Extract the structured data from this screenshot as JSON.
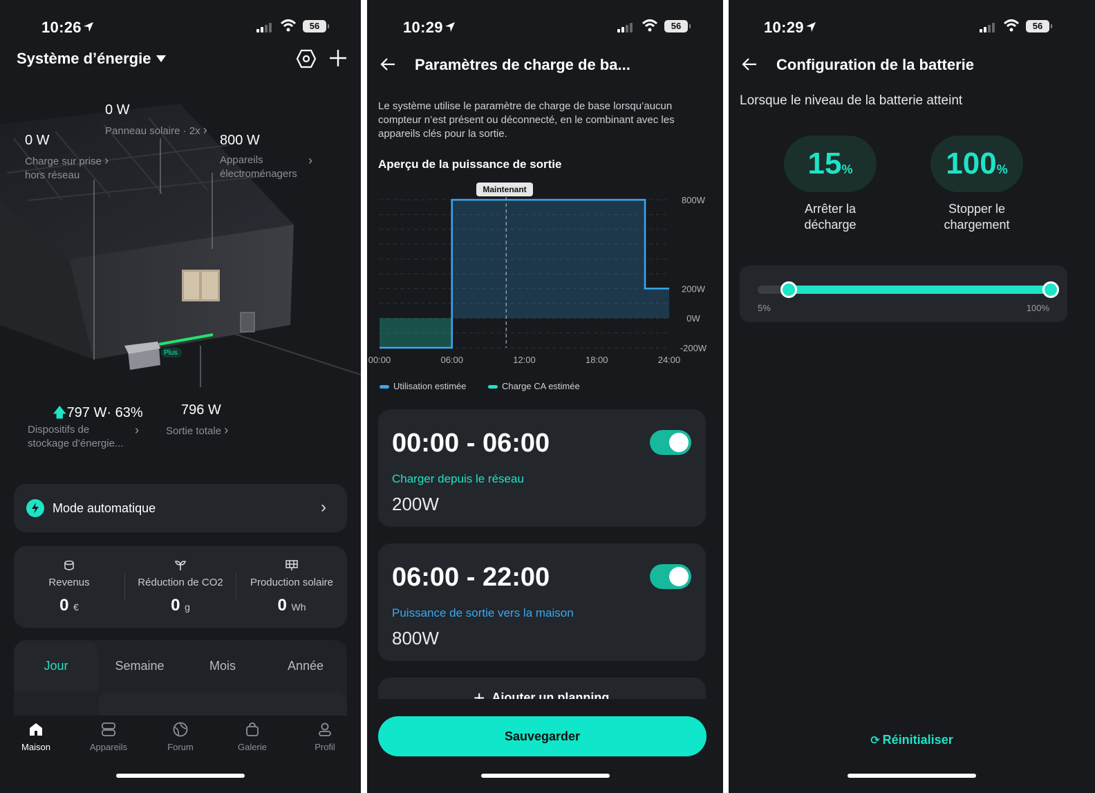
{
  "status": {
    "screen1_time": "10:26",
    "screen2_time": "10:29",
    "screen3_time": "10:29",
    "battery": "56"
  },
  "screen1": {
    "title": "Système d’énergie",
    "solar": {
      "value": "0 W",
      "label": "Panneau solaire · 2x"
    },
    "offgrid": {
      "value": "0 W",
      "label_line1": "Charge sur prise",
      "label_line2": "hors réseau"
    },
    "appliances": {
      "value": "800 W",
      "label_line1": "Appareils",
      "label_line2": "électroménagers"
    },
    "storage": {
      "value": "797 W· 63%",
      "label_line1": "Dispositifs de",
      "label_line2": "stockage d’énergie..."
    },
    "output": {
      "value": "796 W",
      "label": "Sortie totale"
    },
    "device_badge": "Plus",
    "auto_mode": "Mode automatique",
    "stats": [
      {
        "label": "Revenus",
        "value": "0",
        "unit": "€"
      },
      {
        "label": "Réduction de CO2",
        "value": "0",
        "unit": "g"
      },
      {
        "label": "Production solaire",
        "value": "0",
        "unit": "Wh"
      }
    ],
    "period_tabs": [
      "Jour",
      "Semaine",
      "Mois",
      "Année"
    ],
    "nav": [
      "Maison",
      "Appareils",
      "Forum",
      "Galerie",
      "Profil"
    ]
  },
  "screen2": {
    "title": "Paramètres de charge de ba...",
    "description": "Le système utilise le paramètre de charge de base lorsqu’aucun compteur n’est présent ou déconnecté, en le combinant avec les appareils clés pour la sortie.",
    "chart_title": "Aperçu de la puissance de sortie",
    "now_label": "Maintenant",
    "legend": [
      "Utilisation estimée",
      "Charge CA estimée"
    ],
    "schedules": [
      {
        "range": "00:00 - 06:00",
        "mode": "Charger depuis le réseau",
        "power": "200W"
      },
      {
        "range": "06:00 - 22:00",
        "mode": "Puissance de sortie vers la maison",
        "power": "800W"
      }
    ],
    "add_schedule": "Ajouter un planning",
    "save": "Sauvegarder"
  },
  "chart_data": {
    "type": "area",
    "x_ticks": [
      "00:00",
      "06:00",
      "12:00",
      "18:00",
      "24:00"
    ],
    "y_ticks": [
      "800W",
      "200W",
      "0W",
      "-200W"
    ],
    "ylim": [
      -200,
      800
    ],
    "xlim": [
      0,
      24
    ],
    "now_hour": 10.5,
    "series": [
      {
        "name": "Utilisation estimée",
        "color": "#3aa8f0",
        "points": [
          [
            0,
            -200
          ],
          [
            6,
            -200
          ],
          [
            6,
            800
          ],
          [
            22,
            800
          ],
          [
            22,
            200
          ],
          [
            24,
            200
          ]
        ]
      },
      {
        "name": "Charge CA estimée",
        "color": "#1fe3c6",
        "points": [
          [
            0,
            0
          ],
          [
            6,
            0
          ]
        ]
      }
    ]
  },
  "screen3": {
    "title": "Configuration de la batterie",
    "subtitle": "Lorsque le niveau de la batterie atteint",
    "discharge": {
      "value": "15",
      "unit": "%",
      "label_line1": "Arrêter la",
      "label_line2": "décharge"
    },
    "charge": {
      "value": "100",
      "unit": "%",
      "label_line1": "Stopper le",
      "label_line2": "chargement"
    },
    "slider": {
      "min_label": "5%",
      "max_label": "100%",
      "min": 5,
      "max": 100,
      "low": 15,
      "high": 100
    },
    "reset": "Réinitialiser"
  },
  "colors": {
    "accent": "#1fe3c6",
    "blue": "#3aa8f0",
    "bg": "#17191d",
    "card": "#23262b"
  }
}
